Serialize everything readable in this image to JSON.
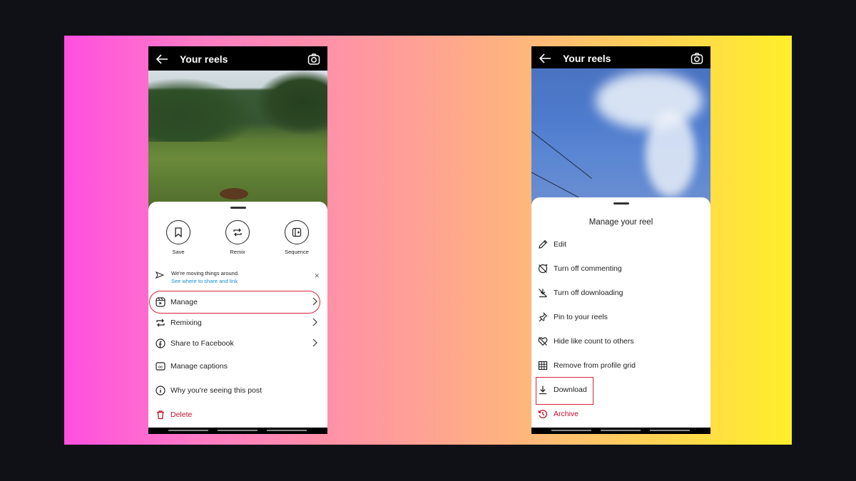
{
  "left_phone": {
    "header": {
      "title": "Your reels"
    },
    "actions": [
      {
        "label": "Save",
        "icon": "bookmark-icon"
      },
      {
        "label": "Remix",
        "icon": "remix-icon"
      },
      {
        "label": "Sequence",
        "icon": "sequence-icon"
      }
    ],
    "notice": {
      "message": "We're moving things around.",
      "link": "See where to share and link"
    },
    "menu": [
      {
        "label": "Manage",
        "icon": "reel-icon",
        "chevron": true,
        "highlighted": true
      },
      {
        "label": "Remixing",
        "icon": "remix-icon",
        "chevron": true
      },
      {
        "label": "Share to Facebook",
        "icon": "facebook-icon",
        "chevron": true
      },
      {
        "label": "Manage captions",
        "icon": "captions-icon",
        "chevron": false
      },
      {
        "label": "Why you're seeing this post",
        "icon": "info-icon",
        "chevron": false
      },
      {
        "label": "Delete",
        "icon": "trash-icon",
        "chevron": false,
        "danger": true
      }
    ]
  },
  "right_phone": {
    "header": {
      "title": "Your reels"
    },
    "sheet_title": "Manage your reel",
    "menu": [
      {
        "label": "Edit",
        "icon": "pencil-icon"
      },
      {
        "label": "Turn off commenting",
        "icon": "comment-off-icon"
      },
      {
        "label": "Turn off downloading",
        "icon": "download-off-icon"
      },
      {
        "label": "Pin to your reels",
        "icon": "pin-icon"
      },
      {
        "label": "Hide like count to others",
        "icon": "heart-off-icon"
      },
      {
        "label": "Remove from profile grid",
        "icon": "grid-icon"
      },
      {
        "label": "Download",
        "icon": "download-icon",
        "highlighted": true
      },
      {
        "label": "Archive",
        "icon": "archive-icon",
        "danger": true
      }
    ]
  },
  "colors": {
    "highlight": "#d8243a",
    "danger": "#c0102a",
    "link": "#1a8fd6"
  }
}
